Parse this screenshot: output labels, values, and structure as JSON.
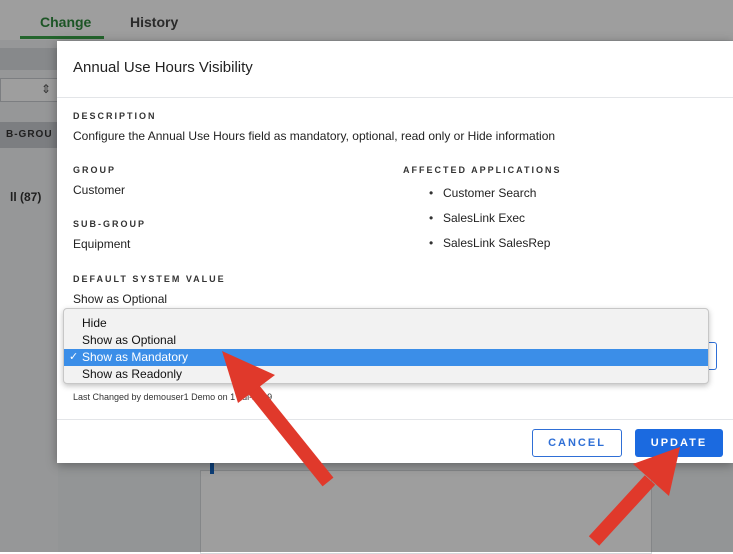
{
  "background": {
    "tabs": [
      {
        "label": "Change"
      },
      {
        "label": "History"
      }
    ],
    "left_group_label": "B-GROU",
    "left_count": "ll (87)",
    "select_caret": "⇕"
  },
  "modal": {
    "title": "Annual Use Hours Visibility",
    "description_label": "DESCRIPTION",
    "description_text": "Configure the Annual Use Hours field as mandatory, optional, read only or Hide information",
    "group_label": "GROUP",
    "group_value": "Customer",
    "subgroup_label": "SUB-GROUP",
    "subgroup_value": "Equipment",
    "affected_label": "AFFECTED APPLICATIONS",
    "affected_apps": [
      "Customer Search",
      "SalesLink Exec",
      "SalesLink SalesRep"
    ],
    "default_label": "DEFAULT SYSTEM VALUE",
    "default_value": "Show as Optional",
    "last_changed": "Last Changed by demouser1 Demo on 1 Jul-2019",
    "cancel_label": "CANCEL",
    "update_label": "UPDATE"
  },
  "dropdown": {
    "options": [
      "Hide",
      "Show as Optional",
      "Show as Mandatory",
      "Show as Readonly"
    ],
    "selected": "Show as Mandatory",
    "check_glyph": "✓"
  },
  "colors": {
    "accent": "#1b6ae0",
    "selection": "#3b8ee8",
    "arrow": "#e0392b",
    "tab_active": "#2f8a3e"
  },
  "icons": [
    "check-icon",
    "arrow-annotation-icon",
    "select-caret-icon"
  ]
}
